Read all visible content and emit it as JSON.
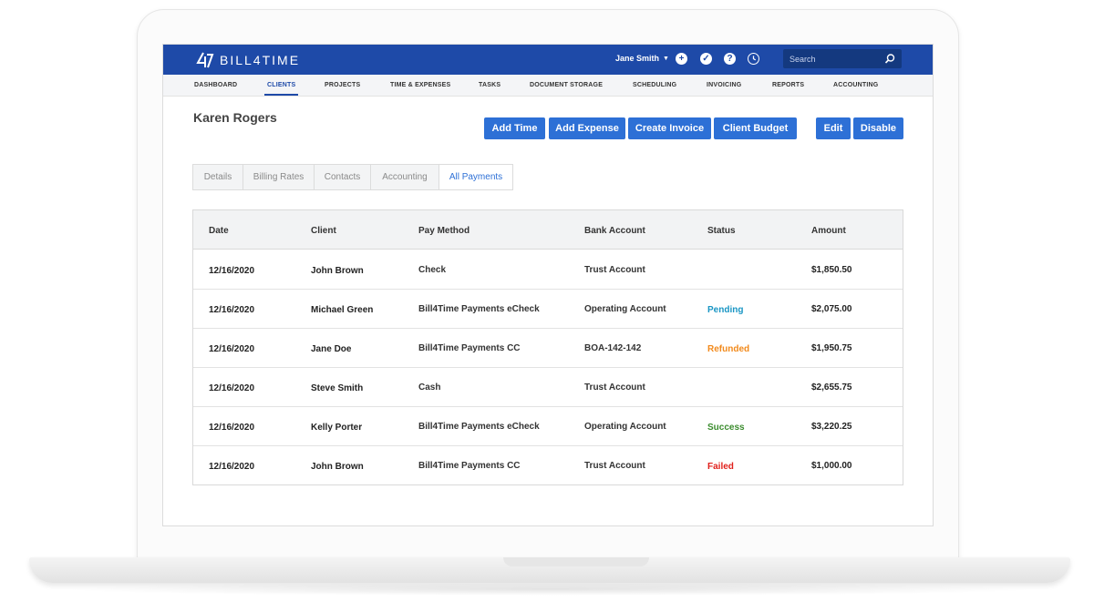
{
  "app": {
    "logo_text": "BILL4TIME",
    "user_name": "Jane Smith",
    "search_placeholder": "Search",
    "icons": [
      "add-circle-icon",
      "check-circle-icon",
      "help-circle-icon",
      "clock-icon",
      "search-icon"
    ]
  },
  "nav": {
    "items": [
      "DASHBOARD",
      "CLIENTS",
      "PROJECTS",
      "TIME & EXPENSES",
      "TASKS",
      "DOCUMENT STORAGE",
      "SCHEDULING",
      "INVOICING",
      "REPORTS",
      "ACCOUNTING"
    ],
    "active": "CLIENTS"
  },
  "client": {
    "name": "Karen Rogers"
  },
  "actions": {
    "add_time": "Add Time",
    "add_expense": "Add Expense",
    "create_invoice": "Create Invoice",
    "client_budget": "Client Budget",
    "edit": "Edit",
    "disable": "Disable"
  },
  "tabs": {
    "items": [
      "Details",
      "Billing Rates",
      "Contacts",
      "Accounting",
      "All Payments"
    ],
    "active": "All Payments"
  },
  "table": {
    "headers": [
      "Date",
      "Client",
      "Pay Method",
      "Bank Account",
      "Status",
      "Amount"
    ],
    "rows": [
      {
        "date": "12/16/2020",
        "client": "John Brown",
        "method": "Check",
        "bank": "Trust Account",
        "status": "",
        "amount": "$1,850.50"
      },
      {
        "date": "12/16/2020",
        "client": "Michael Green",
        "method": "Bill4Time Payments eCheck",
        "bank": "Operating Account",
        "status": "Pending",
        "amount": "$2,075.00"
      },
      {
        "date": "12/16/2020",
        "client": "Jane Doe",
        "method": "Bill4Time Payments CC",
        "bank": "BOA-142-142",
        "status": "Refunded",
        "amount": "$1,950.75"
      },
      {
        "date": "12/16/2020",
        "client": "Steve Smith",
        "method": "Cash",
        "bank": "Trust Account",
        "status": "",
        "amount": "$2,655.75"
      },
      {
        "date": "12/16/2020",
        "client": "Kelly Porter",
        "method": "Bill4Time Payments eCheck",
        "bank": "Operating Account",
        "status": "Success",
        "amount": "$3,220.25"
      },
      {
        "date": "12/16/2020",
        "client": "John Brown",
        "method": "Bill4Time Payments CC",
        "bank": "Trust Account",
        "status": "Failed",
        "amount": "$1,000.00"
      }
    ]
  },
  "colors": {
    "brand": "#1e4aa8",
    "button": "#2d70d6",
    "Pending": "#1a96c4",
    "Refunded": "#f28a1c",
    "Success": "#3b8c2e",
    "Failed": "#e0201b"
  }
}
